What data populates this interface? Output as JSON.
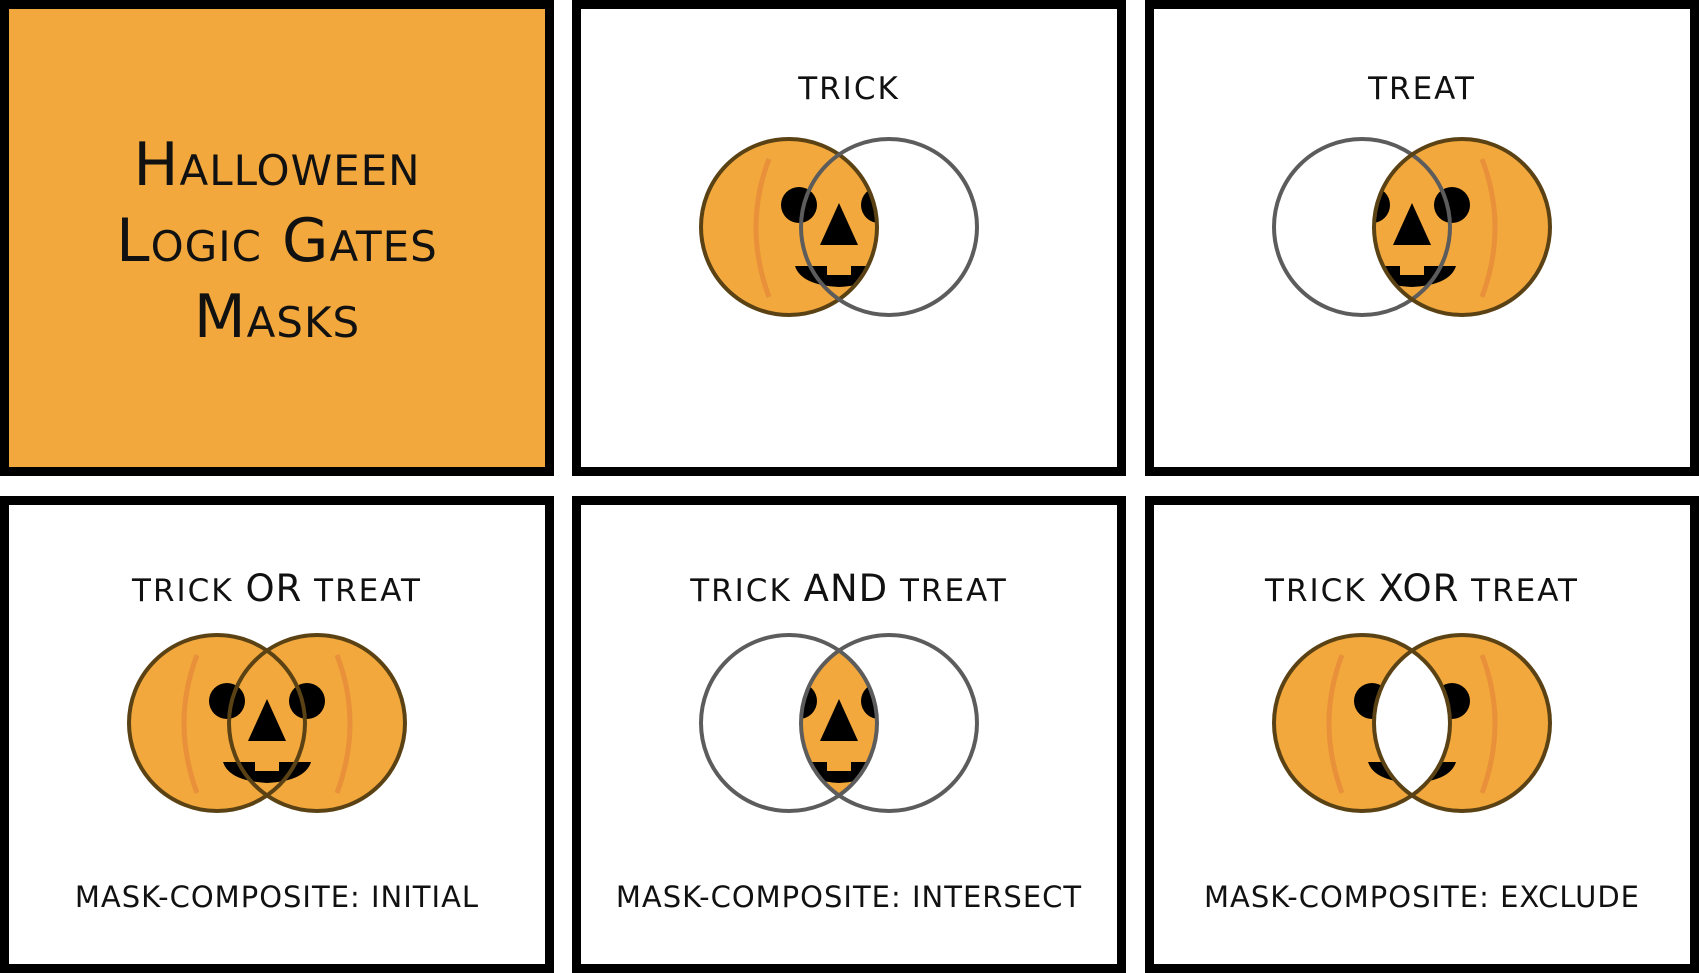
{
  "title": {
    "lines": [
      "Halloween",
      "Logic Gates",
      "Masks"
    ]
  },
  "panels": [
    {
      "id": "trick",
      "heading": "trick",
      "operator": "",
      "heading_b": "",
      "caption": "",
      "show": "a"
    },
    {
      "id": "treat",
      "heading": "treat",
      "operator": "",
      "heading_b": "",
      "caption": "",
      "show": "b"
    },
    {
      "id": "or",
      "heading": "trick",
      "operator": "OR",
      "heading_b": "treat",
      "caption": "mask-composite: initial",
      "show": "or"
    },
    {
      "id": "and",
      "heading": "trick",
      "operator": "AND",
      "heading_b": "treat",
      "caption": "mask-composite: intersect",
      "show": "and"
    },
    {
      "id": "xor",
      "heading": "trick",
      "operator": "XOR",
      "heading_b": "treat",
      "caption": "mask-composite: exclude",
      "show": "xor"
    }
  ],
  "colors": {
    "pumpkin": "#f2a83c",
    "pumpkin_rib": "#e8903a",
    "outline": "#5a4214",
    "empty_outline": "#5c5c5c",
    "face": "#000000",
    "border": "#000000"
  }
}
